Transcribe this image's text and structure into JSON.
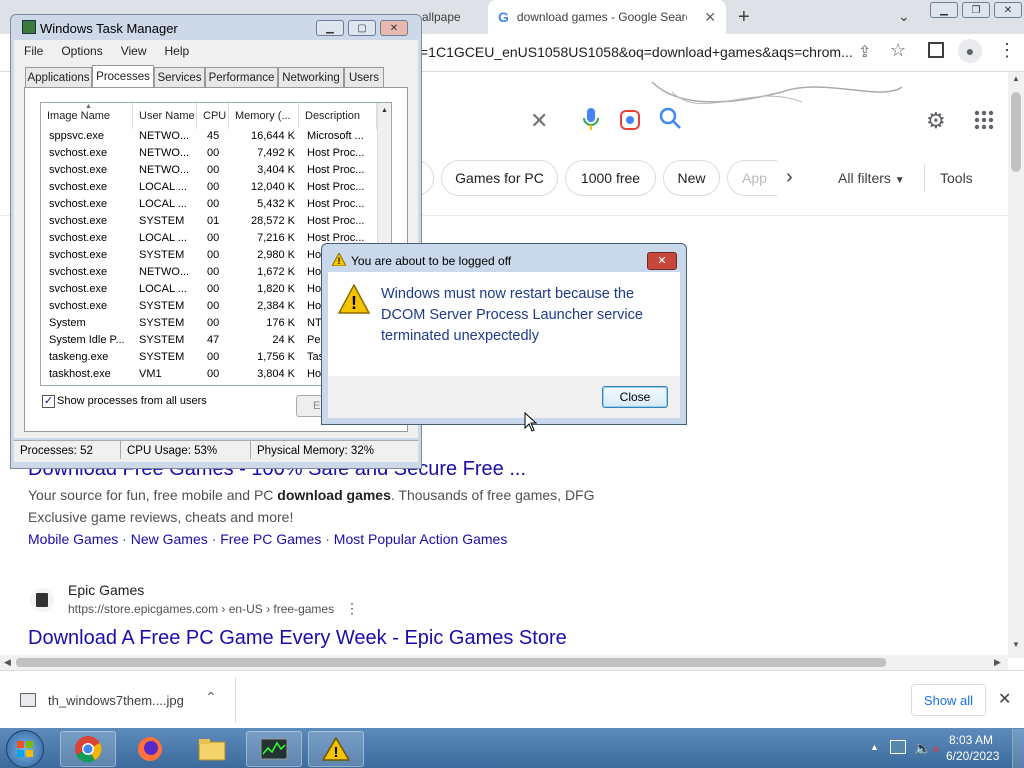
{
  "browser": {
    "tabs": [
      {
        "label": "allpape"
      },
      {
        "label": "download games - Google Search",
        "active": true
      }
    ],
    "new_tab_icon": "plus-icon",
    "url": "=1C1GCEU_enUS1058US1058&oq=download+games&aqs=chrom...",
    "window_buttons": [
      "minimize",
      "restore",
      "close"
    ]
  },
  "google": {
    "chips": [
      "Games for PC",
      "1000 free",
      "New",
      "App"
    ],
    "all_filters": "All filters",
    "tools": "Tools",
    "results": [
      {
        "title": "Download Free Games - 100% Safe and Secure Free ...",
        "snippet_line1_pre": "Your source for fun, free mobile and PC ",
        "snippet_line1_bold": "download games",
        "snippet_line1_post": ". Thousands of free games, DFG",
        "snippet_line2": "Exclusive game reviews, cheats and more!",
        "sublinks": [
          "Mobile Games",
          "New Games",
          "Free PC Games",
          "Most Popular Action Games"
        ]
      },
      {
        "site": "Epic Games",
        "url": "https://store.epicgames.com › en-US › free-games",
        "title": "Download A Free PC Game Every Week - Epic Games Store"
      }
    ]
  },
  "download_shelf": {
    "file": "th_windows7them....jpg",
    "show_all": "Show all"
  },
  "task_manager": {
    "title": "Windows Task Manager",
    "menu": [
      "File",
      "Options",
      "View",
      "Help"
    ],
    "tabs": [
      "Applications",
      "Processes",
      "Services",
      "Performance",
      "Networking",
      "Users"
    ],
    "selected_tab": "Processes",
    "columns": [
      "Image Name",
      "User Name",
      "CPU",
      "Memory (...",
      "Description"
    ],
    "rows": [
      [
        "sppsvc.exe",
        "NETWO...",
        "45",
        "16,644 K",
        "Microsoft ..."
      ],
      [
        "svchost.exe",
        "NETWO...",
        "00",
        "7,492 K",
        "Host Proc..."
      ],
      [
        "svchost.exe",
        "NETWO...",
        "00",
        "3,404 K",
        "Host Proc..."
      ],
      [
        "svchost.exe",
        "LOCAL ...",
        "00",
        "12,040 K",
        "Host Proc..."
      ],
      [
        "svchost.exe",
        "LOCAL ...",
        "00",
        "5,432 K",
        "Host Proc..."
      ],
      [
        "svchost.exe",
        "SYSTEM",
        "01",
        "28,572 K",
        "Host Proc..."
      ],
      [
        "svchost.exe",
        "LOCAL ...",
        "00",
        "7,216 K",
        "Host Proc..."
      ],
      [
        "svchost.exe",
        "SYSTEM",
        "00",
        "2,980 K",
        "Hos"
      ],
      [
        "svchost.exe",
        "NETWO...",
        "00",
        "1,672 K",
        "Hos"
      ],
      [
        "svchost.exe",
        "LOCAL ...",
        "00",
        "1,820 K",
        "Hos"
      ],
      [
        "svchost.exe",
        "SYSTEM",
        "00",
        "2,384 K",
        "Hos"
      ],
      [
        "System",
        "SYSTEM",
        "00",
        "176 K",
        "NT"
      ],
      [
        "System Idle P...",
        "SYSTEM",
        "47",
        "24 K",
        "Per"
      ],
      [
        "taskeng.exe",
        "SYSTEM",
        "00",
        "1,756 K",
        "Tas"
      ],
      [
        "taskhost.exe",
        "VM1",
        "00",
        "3,804 K",
        "Hos"
      ]
    ],
    "show_all_label": "Show processes from all users",
    "end_button": "E",
    "status": {
      "processes": "Processes: 52",
      "cpu": "CPU Usage: 53%",
      "memory": "Physical Memory: 32%"
    }
  },
  "dialog": {
    "title": "You are about to be logged off",
    "message": "Windows must now restart because the DCOM Server Process Launcher service terminated unexpectedly",
    "close_button": "Close"
  },
  "taskbar": {
    "time": "8:03 AM",
    "date": "6/20/2023",
    "apps": [
      "chrome-icon",
      "firefox-icon",
      "explorer-icon",
      "task-manager-icon",
      "warning-icon"
    ]
  }
}
